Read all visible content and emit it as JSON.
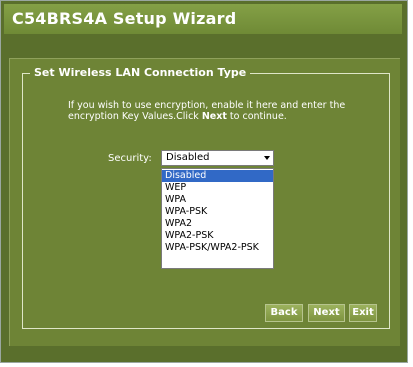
{
  "window": {
    "title": "C54BRS4A Setup Wizard"
  },
  "section": {
    "legend": "Set Wireless LAN Connection Type",
    "description_pre": "If you wish to use encryption, enable it here and enter the encryption Key Values.Click ",
    "description_bold": "Next",
    "description_post": " to continue."
  },
  "security": {
    "label": "Security:",
    "selected": "Disabled",
    "options": [
      "Disabled",
      "WEP",
      "WPA",
      "WPA-PSK",
      "WPA2",
      "WPA2-PSK",
      "WPA-PSK/WPA2-PSK"
    ]
  },
  "buttons": {
    "back": "Back",
    "next": "Next",
    "exit": "Exit"
  },
  "colors": {
    "background": "#5a6f2c",
    "panel": "#6e8436",
    "highlight": "#3169c6"
  }
}
